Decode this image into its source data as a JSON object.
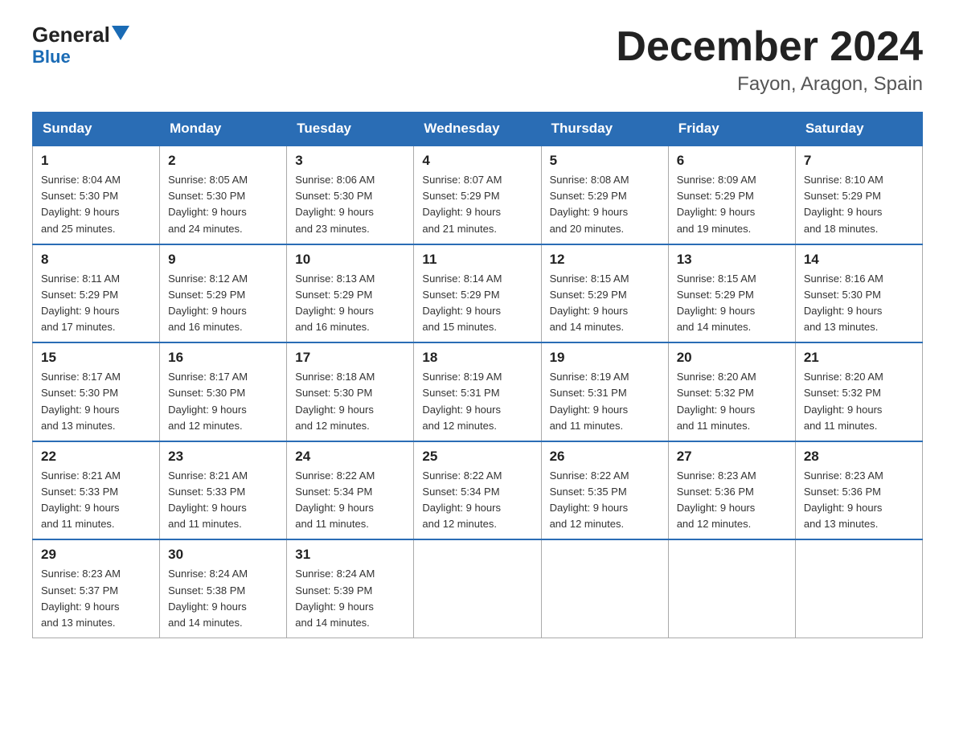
{
  "logo": {
    "general": "General",
    "blue": "Blue"
  },
  "title": "December 2024",
  "location": "Fayon, Aragon, Spain",
  "weekdays": [
    "Sunday",
    "Monday",
    "Tuesday",
    "Wednesday",
    "Thursday",
    "Friday",
    "Saturday"
  ],
  "weeks": [
    [
      {
        "day": "1",
        "sunrise": "8:04 AM",
        "sunset": "5:30 PM",
        "daylight": "9 hours and 25 minutes."
      },
      {
        "day": "2",
        "sunrise": "8:05 AM",
        "sunset": "5:30 PM",
        "daylight": "9 hours and 24 minutes."
      },
      {
        "day": "3",
        "sunrise": "8:06 AM",
        "sunset": "5:30 PM",
        "daylight": "9 hours and 23 minutes."
      },
      {
        "day": "4",
        "sunrise": "8:07 AM",
        "sunset": "5:29 PM",
        "daylight": "9 hours and 21 minutes."
      },
      {
        "day": "5",
        "sunrise": "8:08 AM",
        "sunset": "5:29 PM",
        "daylight": "9 hours and 20 minutes."
      },
      {
        "day": "6",
        "sunrise": "8:09 AM",
        "sunset": "5:29 PM",
        "daylight": "9 hours and 19 minutes."
      },
      {
        "day": "7",
        "sunrise": "8:10 AM",
        "sunset": "5:29 PM",
        "daylight": "9 hours and 18 minutes."
      }
    ],
    [
      {
        "day": "8",
        "sunrise": "8:11 AM",
        "sunset": "5:29 PM",
        "daylight": "9 hours and 17 minutes."
      },
      {
        "day": "9",
        "sunrise": "8:12 AM",
        "sunset": "5:29 PM",
        "daylight": "9 hours and 16 minutes."
      },
      {
        "day": "10",
        "sunrise": "8:13 AM",
        "sunset": "5:29 PM",
        "daylight": "9 hours and 16 minutes."
      },
      {
        "day": "11",
        "sunrise": "8:14 AM",
        "sunset": "5:29 PM",
        "daylight": "9 hours and 15 minutes."
      },
      {
        "day": "12",
        "sunrise": "8:15 AM",
        "sunset": "5:29 PM",
        "daylight": "9 hours and 14 minutes."
      },
      {
        "day": "13",
        "sunrise": "8:15 AM",
        "sunset": "5:29 PM",
        "daylight": "9 hours and 14 minutes."
      },
      {
        "day": "14",
        "sunrise": "8:16 AM",
        "sunset": "5:30 PM",
        "daylight": "9 hours and 13 minutes."
      }
    ],
    [
      {
        "day": "15",
        "sunrise": "8:17 AM",
        "sunset": "5:30 PM",
        "daylight": "9 hours and 13 minutes."
      },
      {
        "day": "16",
        "sunrise": "8:17 AM",
        "sunset": "5:30 PM",
        "daylight": "9 hours and 12 minutes."
      },
      {
        "day": "17",
        "sunrise": "8:18 AM",
        "sunset": "5:30 PM",
        "daylight": "9 hours and 12 minutes."
      },
      {
        "day": "18",
        "sunrise": "8:19 AM",
        "sunset": "5:31 PM",
        "daylight": "9 hours and 12 minutes."
      },
      {
        "day": "19",
        "sunrise": "8:19 AM",
        "sunset": "5:31 PM",
        "daylight": "9 hours and 11 minutes."
      },
      {
        "day": "20",
        "sunrise": "8:20 AM",
        "sunset": "5:32 PM",
        "daylight": "9 hours and 11 minutes."
      },
      {
        "day": "21",
        "sunrise": "8:20 AM",
        "sunset": "5:32 PM",
        "daylight": "9 hours and 11 minutes."
      }
    ],
    [
      {
        "day": "22",
        "sunrise": "8:21 AM",
        "sunset": "5:33 PM",
        "daylight": "9 hours and 11 minutes."
      },
      {
        "day": "23",
        "sunrise": "8:21 AM",
        "sunset": "5:33 PM",
        "daylight": "9 hours and 11 minutes."
      },
      {
        "day": "24",
        "sunrise": "8:22 AM",
        "sunset": "5:34 PM",
        "daylight": "9 hours and 11 minutes."
      },
      {
        "day": "25",
        "sunrise": "8:22 AM",
        "sunset": "5:34 PM",
        "daylight": "9 hours and 12 minutes."
      },
      {
        "day": "26",
        "sunrise": "8:22 AM",
        "sunset": "5:35 PM",
        "daylight": "9 hours and 12 minutes."
      },
      {
        "day": "27",
        "sunrise": "8:23 AM",
        "sunset": "5:36 PM",
        "daylight": "9 hours and 12 minutes."
      },
      {
        "day": "28",
        "sunrise": "8:23 AM",
        "sunset": "5:36 PM",
        "daylight": "9 hours and 13 minutes."
      }
    ],
    [
      {
        "day": "29",
        "sunrise": "8:23 AM",
        "sunset": "5:37 PM",
        "daylight": "9 hours and 13 minutes."
      },
      {
        "day": "30",
        "sunrise": "8:24 AM",
        "sunset": "5:38 PM",
        "daylight": "9 hours and 14 minutes."
      },
      {
        "day": "31",
        "sunrise": "8:24 AM",
        "sunset": "5:39 PM",
        "daylight": "9 hours and 14 minutes."
      },
      null,
      null,
      null,
      null
    ]
  ],
  "labels": {
    "sunrise": "Sunrise:",
    "sunset": "Sunset:",
    "daylight": "Daylight:"
  }
}
